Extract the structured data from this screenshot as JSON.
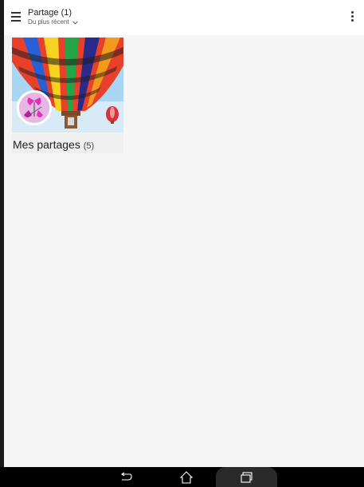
{
  "header": {
    "title": "Partage (1)",
    "sort_label": "Du plus récent"
  },
  "icons": {
    "menu": "hamburger-menu-icon",
    "sort": "chevron-down-icon",
    "more": "more-vert-icon",
    "back": "back-icon",
    "home": "home-icon",
    "recent": "recent-apps-icon"
  },
  "albums": [
    {
      "name": "Mes partages",
      "count": "(5)"
    }
  ],
  "colors": {
    "toolbar_bg": "#ffffff",
    "page_bg": "#f5f5f5",
    "navbar_bg": "#000000"
  }
}
